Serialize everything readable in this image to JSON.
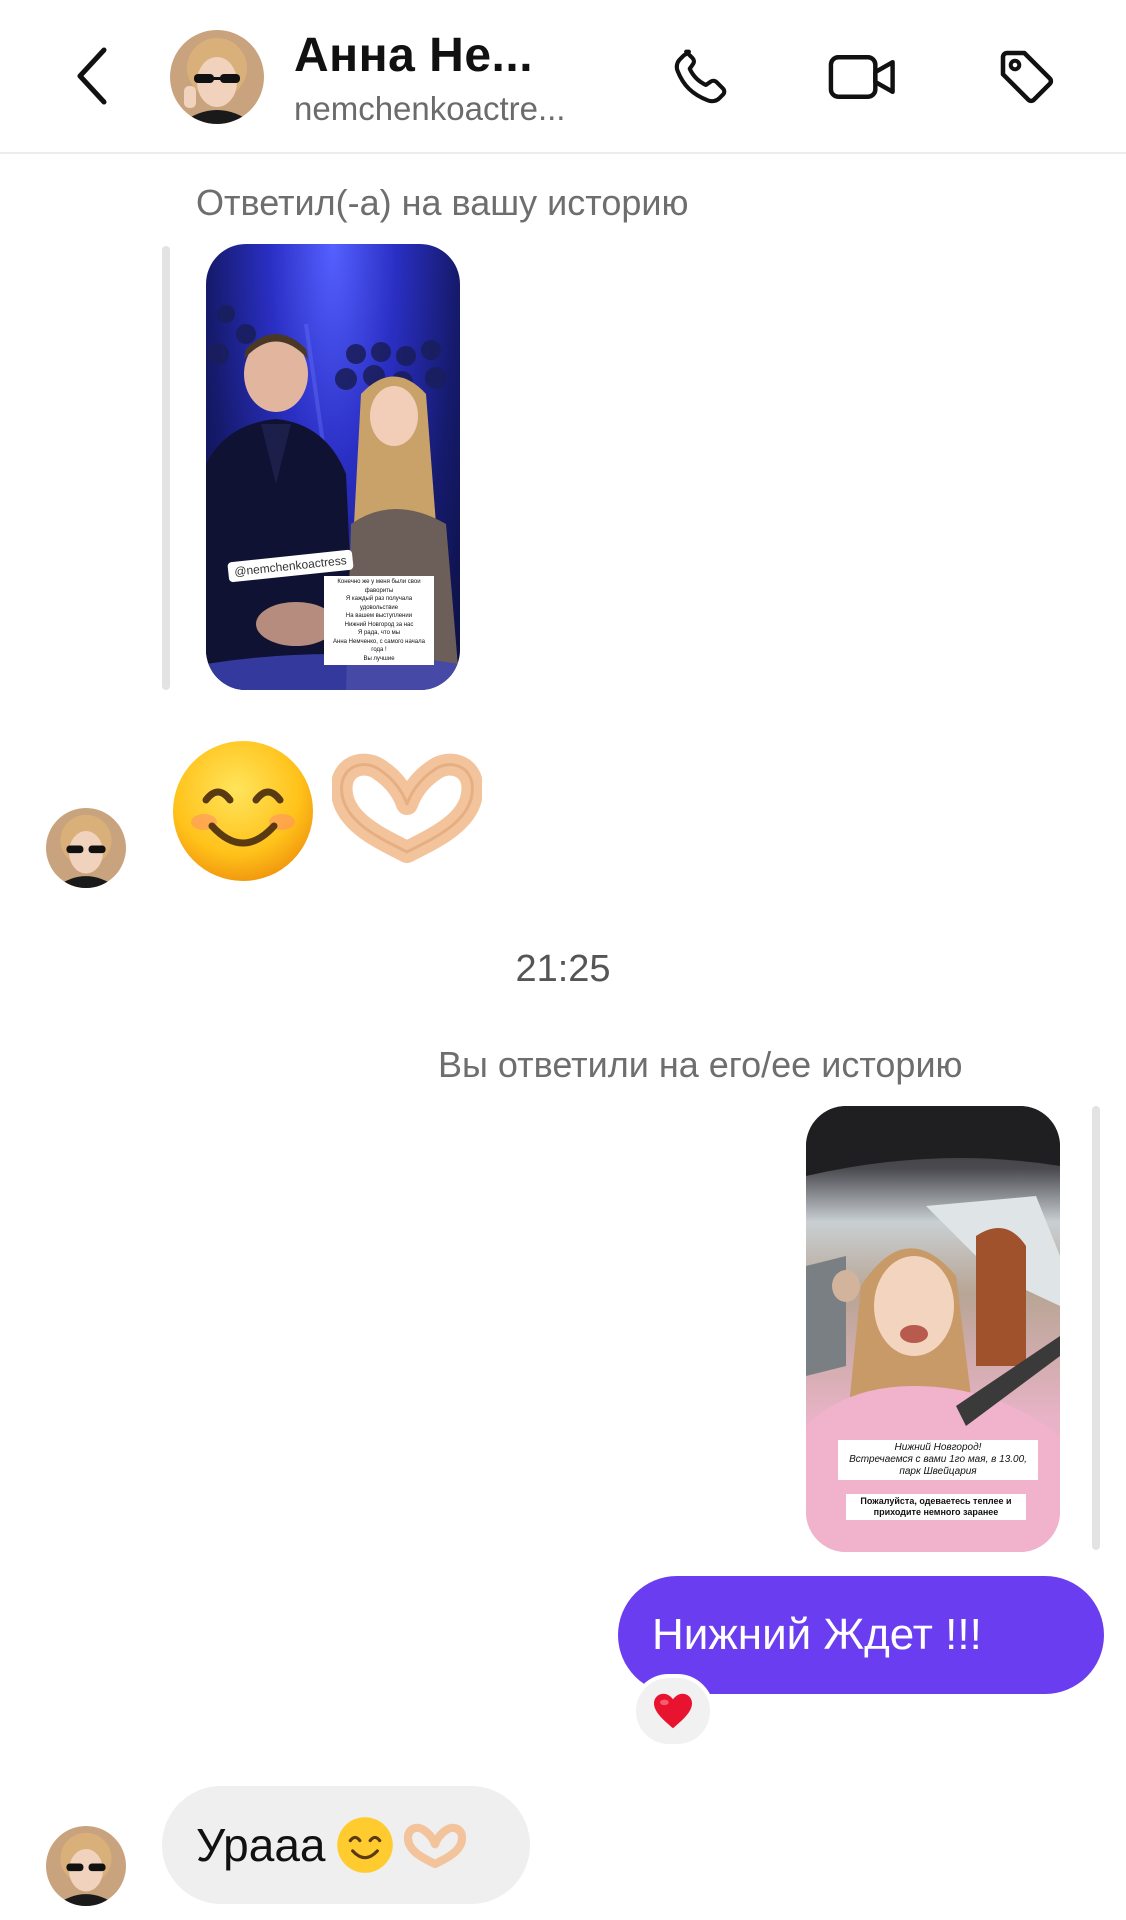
{
  "header": {
    "name": "Анна Не...",
    "username": "nemchenkoactre...",
    "icons": {
      "back": "chevron-left-icon",
      "call": "phone-icon",
      "video": "video-camera-icon",
      "tag": "tag-icon"
    }
  },
  "messages": {
    "reply_to_story_label": "Ответил(-а) на вашу историю",
    "story1": {
      "mention": "@nemchenkoactress",
      "caption_lines": [
        "Конечно же у меня были свои фавориты",
        "Я каждый раз получала удовольствие",
        "На вашем выступлении",
        "Нижний Новгород за нас",
        "Я рада, что мы",
        "Анна Немченко, с самого начала",
        "года !",
        "Вы лучшие"
      ]
    },
    "emoji_reply": {
      "icons": [
        "smiling-face-icon",
        "heart-hands-icon"
      ]
    },
    "timestamp": "21:25",
    "you_replied_label": "Вы ответили на его/ее историю",
    "story2": {
      "caption_lines": [
        "Нижний Новгород!",
        "Встречаемся с вами 1го мая, в 13.00,",
        "парк Швейцария"
      ],
      "note_lines": [
        "Пожалуйста, одеваетесь теплее и",
        "приходите немного заранее"
      ]
    },
    "outgoing_text": "Нижний Ждет !!!",
    "reaction_icon": "red-heart-icon",
    "incoming_text": "Урааа"
  },
  "colors": {
    "accent": "#6b3df0",
    "incoming_bubble": "#efeff0",
    "muted_text": "#6e6e6e"
  }
}
